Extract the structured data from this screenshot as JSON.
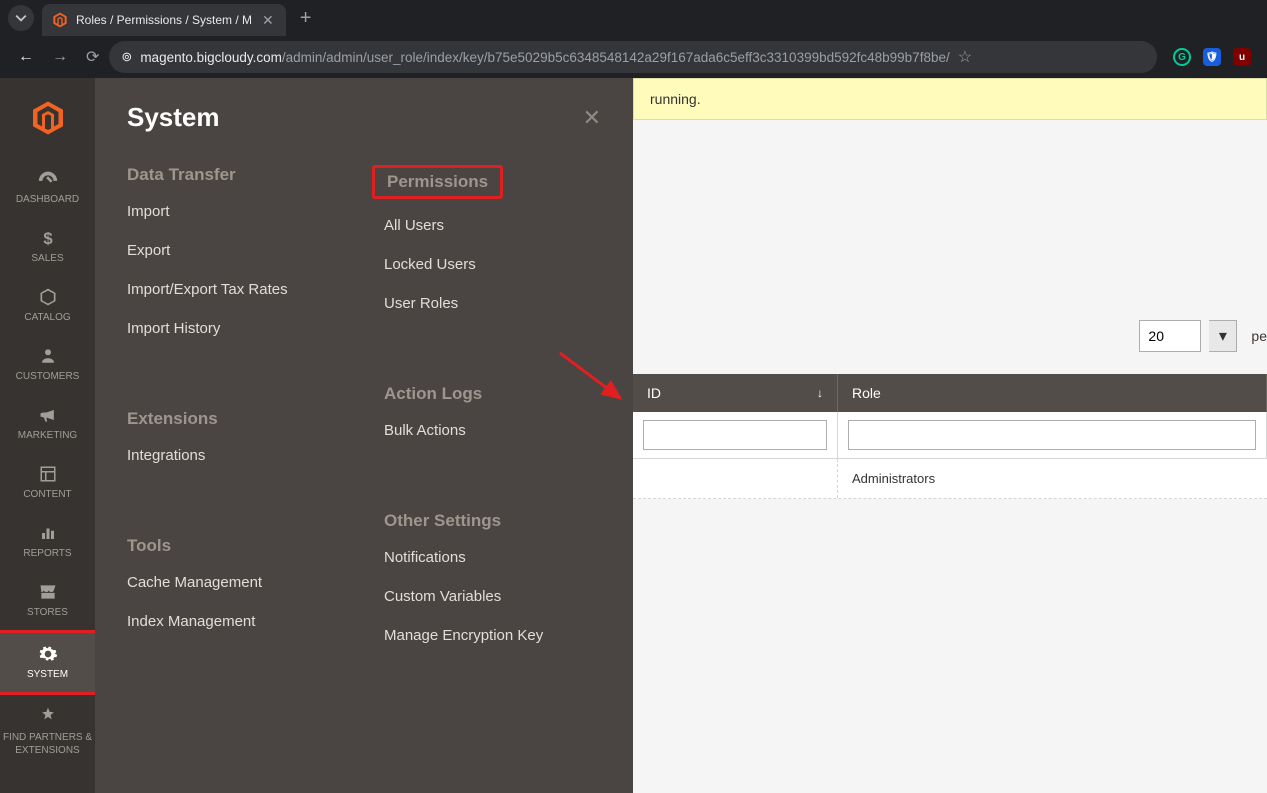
{
  "browser": {
    "tab_title": "Roles / Permissions / System / M",
    "url_host": "magento.bigcloudy.com",
    "url_path": "/admin/admin/user_role/index/key/b75e5029b5c6348548142a29f167ada6c5eff3c3310399bd592fc48b99b7f8be/"
  },
  "sidebar": {
    "items": [
      {
        "label": "DASHBOARD",
        "icon": "gauge-icon"
      },
      {
        "label": "SALES",
        "icon": "dollar-icon"
      },
      {
        "label": "CATALOG",
        "icon": "cube-icon"
      },
      {
        "label": "CUSTOMERS",
        "icon": "person-icon"
      },
      {
        "label": "MARKETING",
        "icon": "megaphone-icon"
      },
      {
        "label": "CONTENT",
        "icon": "layout-icon"
      },
      {
        "label": "REPORTS",
        "icon": "bars-icon"
      },
      {
        "label": "STORES",
        "icon": "storefront-icon"
      },
      {
        "label": "SYSTEM",
        "icon": "gear-icon"
      },
      {
        "label": "FIND PARTNERS & EXTENSIONS",
        "icon": "partners-icon"
      }
    ]
  },
  "flyout": {
    "title": "System",
    "col1": {
      "data_transfer": {
        "header": "Data Transfer",
        "items": [
          "Import",
          "Export",
          "Import/Export Tax Rates",
          "Import History"
        ]
      },
      "extensions": {
        "header": "Extensions",
        "items": [
          "Integrations"
        ]
      },
      "tools": {
        "header": "Tools",
        "items": [
          "Cache Management",
          "Index Management"
        ]
      }
    },
    "col2": {
      "permissions": {
        "header": "Permissions",
        "items": [
          "All Users",
          "Locked Users",
          "User Roles"
        ]
      },
      "action_logs": {
        "header": "Action Logs",
        "items": [
          "Bulk Actions"
        ]
      },
      "other_settings": {
        "header": "Other Settings",
        "items": [
          "Notifications",
          "Custom Variables",
          "Manage Encryption Key"
        ]
      }
    }
  },
  "content": {
    "notice_fragment": "running.",
    "per_page_value": "20",
    "per_page_suffix": "pe",
    "columns": {
      "id": "ID",
      "role": "Role"
    },
    "rows": [
      {
        "id": "",
        "role": "Administrators"
      }
    ]
  },
  "colors": {
    "chrome_bg": "#202124",
    "admin_sidebar": "#373330",
    "flyout_bg": "#4a4542",
    "magento_orange": "#f26322",
    "highlight_red": "#e02020",
    "notice_bg": "#fffbbb"
  }
}
